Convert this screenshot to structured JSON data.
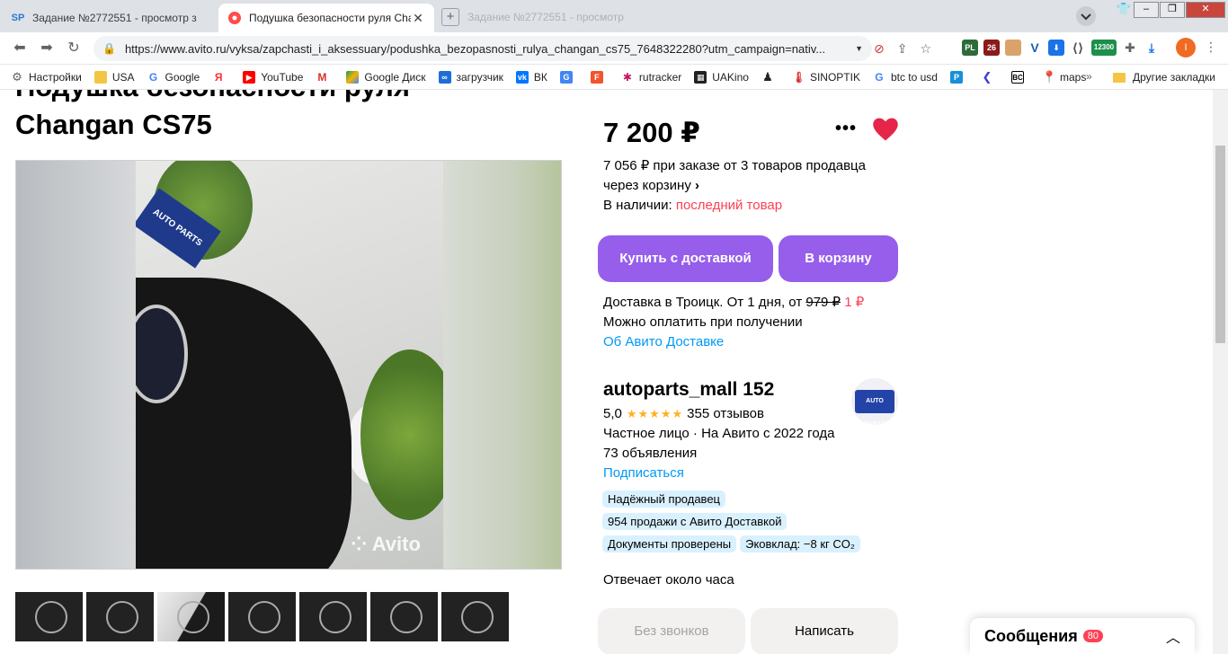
{
  "browser": {
    "tabs": [
      {
        "label": "Задание №2772551 - просмотр з",
        "icon": "SP"
      },
      {
        "label": "Подушка безопасности руля Chan",
        "icon": "avito-dot"
      }
    ],
    "ghost_tab": "Задание №2772551 - просмотр",
    "url": "https://www.avito.ru/vyksa/zapchasti_i_aksessuary/podushka_bezopasnosti_rulya_changan_cs75_7648322280?utm_campaign=nativ...",
    "extension_badges": {
      "pl": "PL",
      "count": "26",
      "price": "12300"
    },
    "profile_initial": "I",
    "bookmarks": [
      {
        "label": "Настройки",
        "icon": "gear"
      },
      {
        "label": "USA",
        "icon": "folder"
      },
      {
        "label": "Google",
        "icon": "G"
      },
      {
        "label": "",
        "icon": "Я"
      },
      {
        "label": "YouTube",
        "icon": "youtube"
      },
      {
        "label": "",
        "icon": "M"
      },
      {
        "label": "Google Диск",
        "icon": "drive"
      },
      {
        "label": "загрузчик",
        "icon": "loader"
      },
      {
        "label": "ВК",
        "icon": "VK"
      },
      {
        "label": "",
        "icon": "translate"
      },
      {
        "label": "",
        "icon": "F"
      },
      {
        "label": "rutracker",
        "icon": "star"
      },
      {
        "label": "UAKino",
        "icon": "uakino"
      },
      {
        "label": "",
        "icon": "chess"
      },
      {
        "label": "SINOPTIK",
        "icon": "thermo"
      },
      {
        "label": "btc to usd",
        "icon": "G"
      },
      {
        "label": "",
        "icon": "P"
      },
      {
        "label": "",
        "icon": "arrow"
      },
      {
        "label": "",
        "icon": "BC"
      },
      {
        "label": "maps",
        "icon": "pin"
      }
    ],
    "bookmarks_more": "»",
    "other_bookmarks": "Другие закладки"
  },
  "listing": {
    "title_line1": "Подушка безопасности руля",
    "title_line2": "Changan CS75",
    "price": "7 200 ₽",
    "promo_price": "7 056 ₽",
    "promo_text_rest": " при заказе от 3 товаров продавца",
    "promo_line2": "через корзину",
    "availability_label": "В наличии: ",
    "availability_value": "последний товар",
    "buy_button": "Купить с доставкой",
    "cart_button": "В корзину",
    "delivery_text": "Доставка в Троицк. От 1 дня, от ",
    "delivery_old_price": "979 ₽",
    "delivery_new_price": "1 ₽",
    "pay_on_receipt": "Можно оплатить при получении",
    "delivery_link": "Об Авито Доставке",
    "watermark": "Avito",
    "photo_tag": "AUTO PARTS"
  },
  "seller": {
    "name": "autoparts_mall 152",
    "rating": "5,0",
    "stars": "★★★★★",
    "reviews": "355 отзывов",
    "type": "Частное лицо · На Авито с 2022 года",
    "ads": "73 объявления",
    "subscribe": "Подписаться",
    "logo_text": "AUTO PARTS",
    "badges": [
      "Надёжный продавец",
      "954 продажи с Авито Доставкой",
      "Документы проверены",
      "Эковклад: −8 кг CO₂"
    ],
    "response": "Отвечает около часа",
    "no_calls_button": "Без звонков",
    "write_button": "Написать"
  },
  "messages": {
    "label": "Сообщения",
    "count": "80"
  },
  "colors": {
    "accent_purple": "#965eeb",
    "red": "#ff4053",
    "link_blue": "#0099f7",
    "badge_bg": "#d9f1ff",
    "star": "#ffb021"
  }
}
